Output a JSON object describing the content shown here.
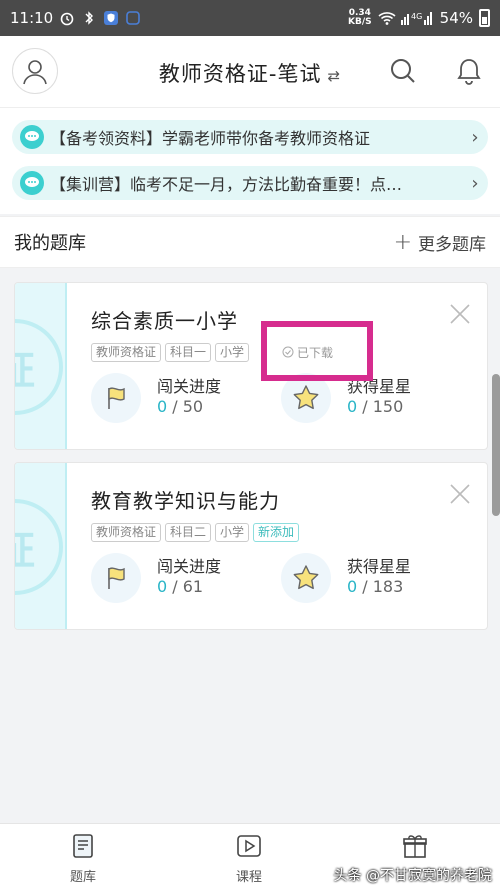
{
  "status_bar": {
    "time": "11:10",
    "net_speed_top": "0.34",
    "net_speed_bottom": "KB/S",
    "signal_label": "4G",
    "battery": "54%"
  },
  "header": {
    "title": "教师资格证-笔试",
    "swap_glyph": "⇄"
  },
  "notices": [
    {
      "text": "【备考领资料】学霸老师带你备考教师资格证"
    },
    {
      "text": "【集训营】临考不足一月，方法比勤奋重要！点…"
    }
  ],
  "section": {
    "title": "我的题库",
    "more_label": "更多题库"
  },
  "cards": [
    {
      "title": "综合素质一小学",
      "stamp": "证",
      "tags": [
        "教师资格证",
        "科目一",
        "小学"
      ],
      "progress_label": "闯关进度",
      "progress_current": "0",
      "progress_total": " / 50",
      "stars_label": "获得星星",
      "stars_current": "0",
      "stars_total": " / 150",
      "downloaded_label": "已下载"
    },
    {
      "title": "教育教学知识与能力",
      "stamp": "证",
      "tags": [
        "教师资格证",
        "科目二",
        "小学"
      ],
      "new_tag": "新添加",
      "progress_label": "闯关进度",
      "progress_current": "0",
      "progress_total": " / 61",
      "stars_label": "获得星星",
      "stars_current": "0",
      "stars_total": " / 183"
    }
  ],
  "bottom_nav": [
    {
      "label": "题库",
      "icon": "book-icon"
    },
    {
      "label": "课程",
      "icon": "play-icon"
    },
    {
      "label": "",
      "icon": "gift-icon"
    }
  ],
  "watermark": "头条 @不甘寂寞的养老院",
  "colors": {
    "accent": "#2ab5c7",
    "notice_bg": "#e3f7f7",
    "highlight": "#d62c8e"
  }
}
